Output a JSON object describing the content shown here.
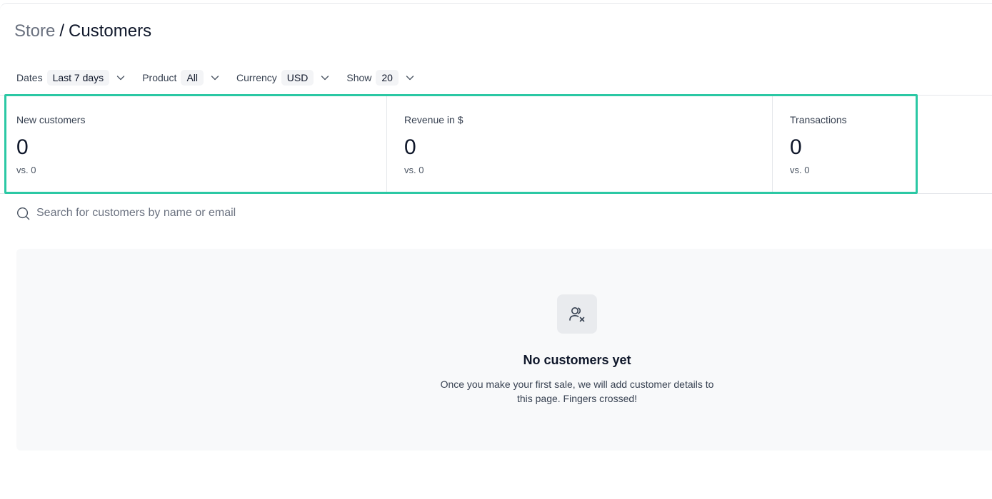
{
  "breadcrumb": {
    "parent": "Store",
    "separator": "/",
    "current": "Customers"
  },
  "filters": [
    {
      "label": "Dates",
      "value": "Last 7 days"
    },
    {
      "label": "Product",
      "value": "All"
    },
    {
      "label": "Currency",
      "value": "USD"
    },
    {
      "label": "Show",
      "value": "20"
    }
  ],
  "stats": [
    {
      "label": "New customers",
      "value": "0",
      "compare": "vs. 0"
    },
    {
      "label": "Revenue in $",
      "value": "0",
      "compare": "vs. 0"
    },
    {
      "label": "Transactions",
      "value": "0",
      "compare": "vs. 0"
    }
  ],
  "search": {
    "placeholder": "Search for customers by name or email",
    "value": ""
  },
  "empty_state": {
    "icon": "user-x-icon",
    "title": "No customers yet",
    "description": "Once you make your first sale, we will add customer details to this page. Fingers crossed!"
  },
  "colors": {
    "highlight": "#2bc8a4",
    "muted_text": "#6b7280",
    "empty_bg": "#f8f9fa"
  }
}
